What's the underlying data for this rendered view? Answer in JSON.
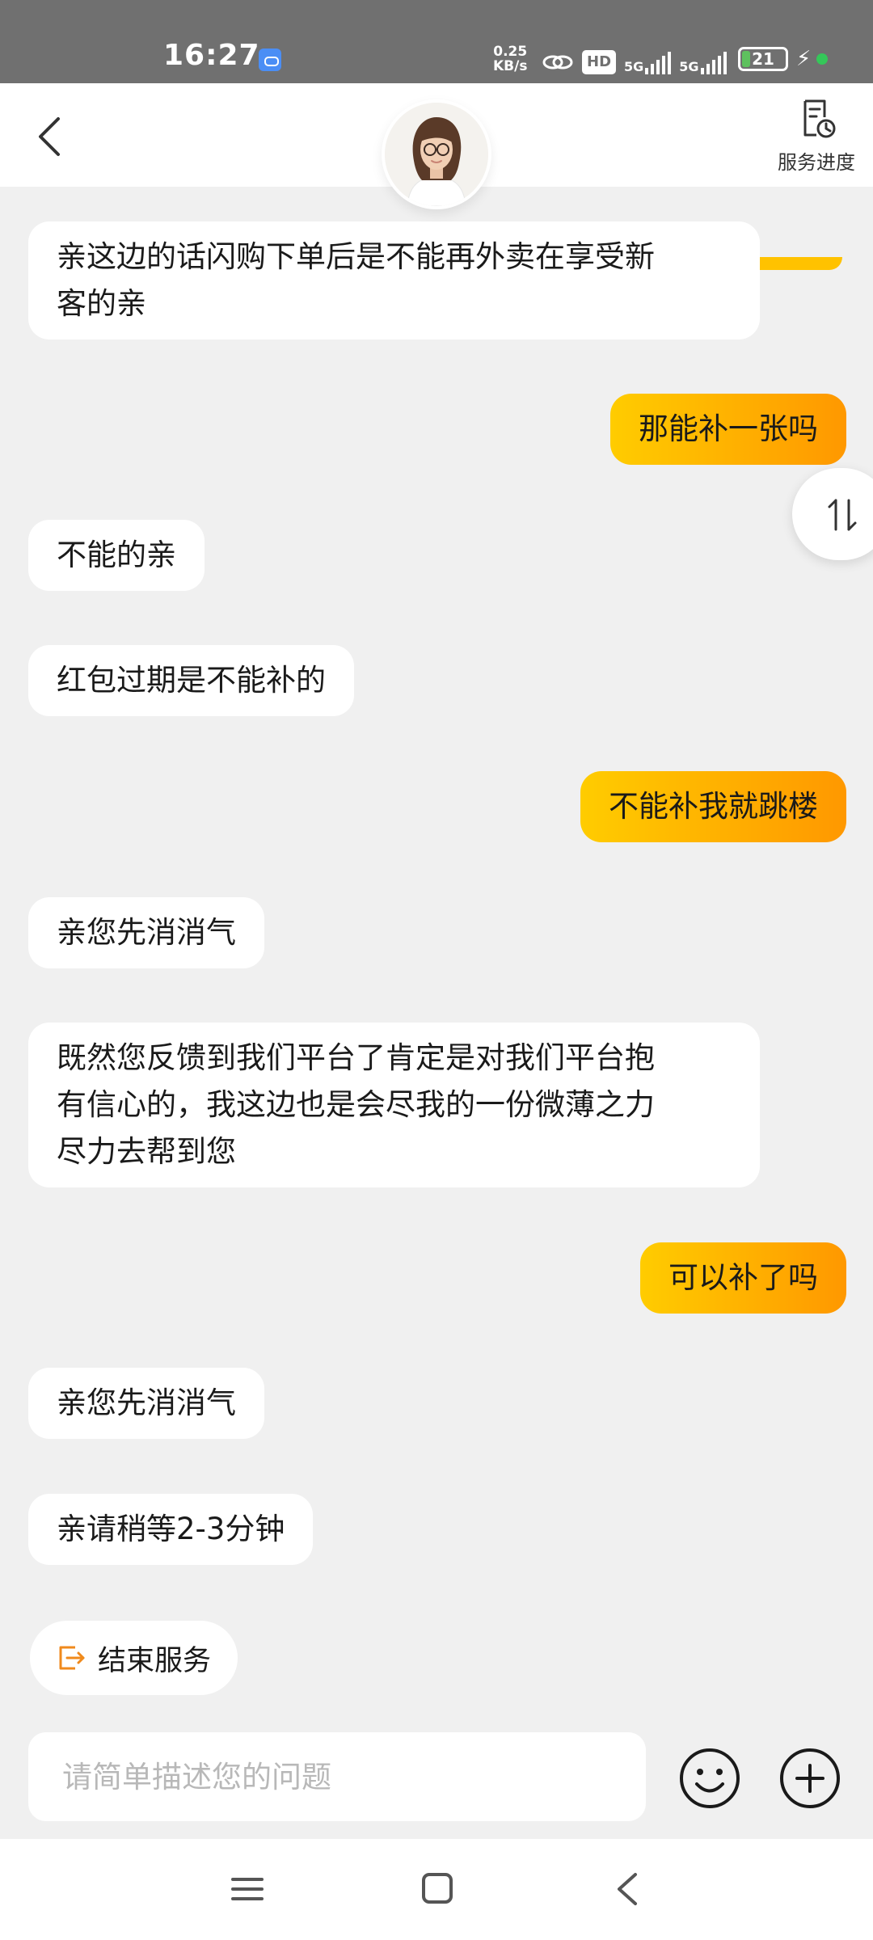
{
  "status_bar": {
    "time": "16:27",
    "net_speed_value": "0.25",
    "net_speed_unit": "KB/s",
    "hd_label": "HD",
    "network_1": "5G",
    "network_2": "5G",
    "battery_level": "21"
  },
  "header": {
    "progress_label": "服务进度"
  },
  "messages": [
    {
      "side": "left",
      "line1": "亲这边的话闪购下单后是不能再外卖在享受新",
      "line2": "客的亲"
    },
    {
      "side": "right",
      "text": "那能补一张吗"
    },
    {
      "side": "left",
      "text": "不能的亲"
    },
    {
      "side": "left",
      "text": "红包过期是不能补的"
    },
    {
      "side": "right",
      "text": "不能补我就跳楼"
    },
    {
      "side": "left",
      "text": "亲您先消消气"
    },
    {
      "side": "left",
      "line1": "既然您反馈到我们平台了肯定是对我们平台抱",
      "line2": "有信心的，我这边也是会尽我的一份微薄之力",
      "line3": "尽力去帮到您"
    },
    {
      "side": "right",
      "text": "可以补了吗"
    },
    {
      "side": "left",
      "text": "亲您先消消气"
    },
    {
      "side": "left",
      "text": "亲请稍等2-3分钟"
    }
  ],
  "actions": {
    "end_service_label": "结束服务"
  },
  "input": {
    "placeholder": "请简单描述您的问题"
  },
  "colors": {
    "user_bubble_start": "#ffcc00",
    "user_bubble_end": "#ff9800",
    "agent_bubble": "#ffffff",
    "accent_orange": "#f08a1c"
  }
}
